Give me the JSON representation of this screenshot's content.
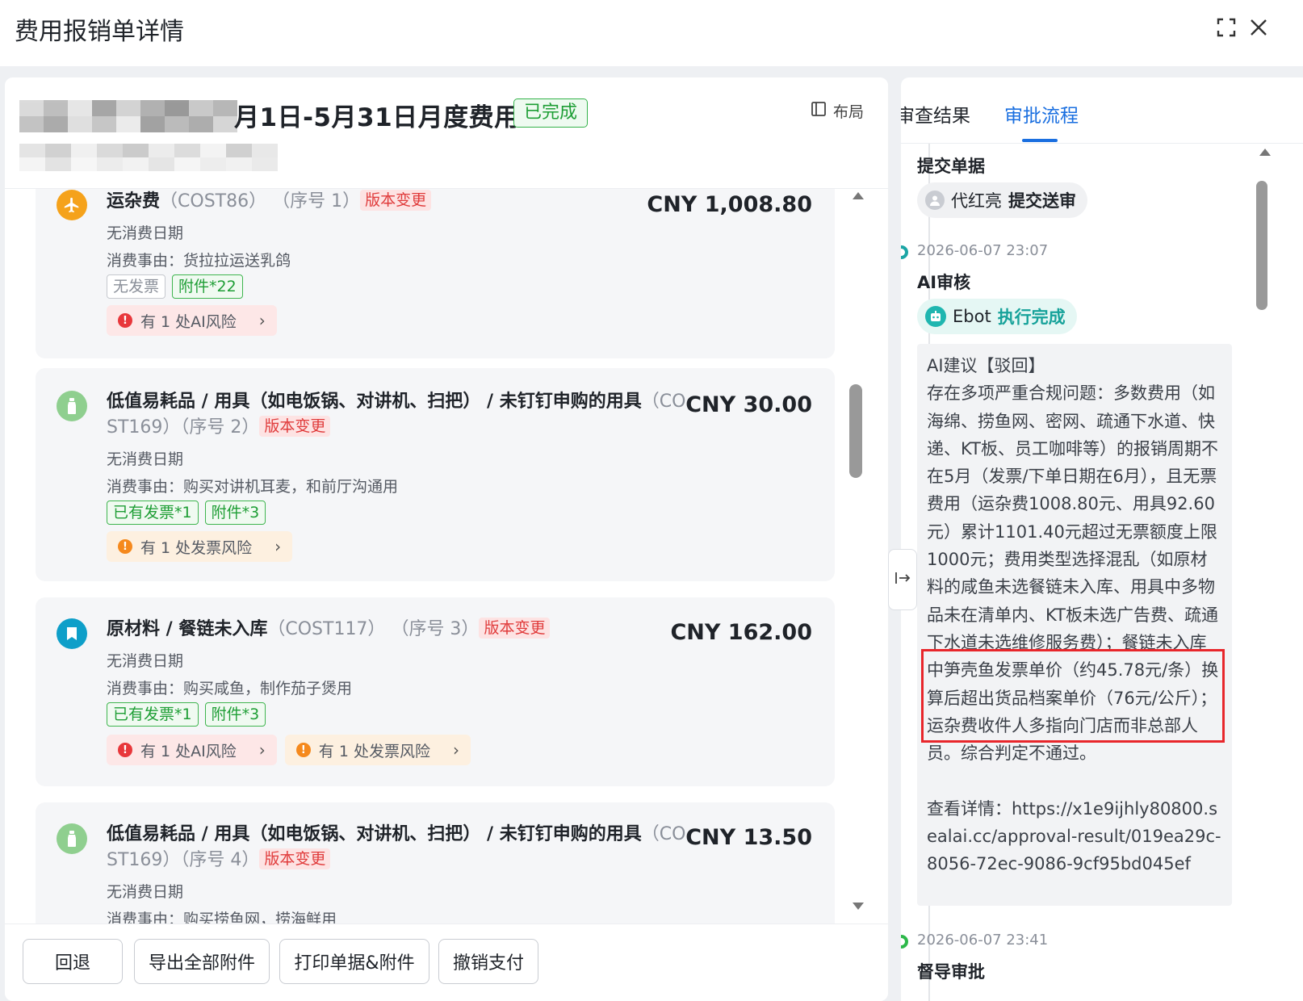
{
  "modal": {
    "title": "费用报销单详情"
  },
  "header": {
    "title_visible": "月1日-5月31日月度费用",
    "status": "已完成",
    "layout_label": "布局"
  },
  "items": [
    {
      "icon": "airplane-icon",
      "icon_color": "#f5a21b",
      "name": "运杂费",
      "code": "（COST86）",
      "seq": "（序号 1）",
      "version_tag": "版本变更",
      "amount": "CNY 1,008.80",
      "date": "无消费日期",
      "reason": "消费事由：货拉拉运送乳鸽",
      "tags": [
        "无发票",
        "附件*22"
      ],
      "risks": [
        "有 1 处AI风险"
      ]
    },
    {
      "icon": "bottle-icon",
      "icon_color": "#8fcf8f",
      "name": "低值易耗品 / 用具（如电饭锅、对讲机、扫把） / 未钉钉申购的用具",
      "code_a": "（CO",
      "code_b": "ST169）",
      "seq": "（序号 2）",
      "version_tag": "版本变更",
      "amount": "CNY 30.00",
      "date": "无消费日期",
      "reason": "消费事由：购买对讲机耳麦，和前厅沟通用",
      "tags": [
        "已有发票*1",
        "附件*3"
      ],
      "risks": [
        "有 1 处发票风险"
      ]
    },
    {
      "icon": "bookmark-icon",
      "icon_color": "#0e9fc9",
      "name": "原材料 / 餐链未入库",
      "code": "（COST117）",
      "seq": "（序号 3）",
      "version_tag": "版本变更",
      "amount": "CNY 162.00",
      "date": "无消费日期",
      "reason": "消费事由：购买咸鱼，制作茄子煲用",
      "tags": [
        "已有发票*1",
        "附件*3"
      ],
      "risks": [
        "有 1 处AI风险",
        "有 1 处发票风险"
      ]
    },
    {
      "icon": "bottle-icon",
      "icon_color": "#8fcf8f",
      "name": "低值易耗品 / 用具（如电饭锅、对讲机、扫把） / 未钉钉申购的用具",
      "code_a": "（CO",
      "code_b": "ST169）",
      "seq": "（序号 4）",
      "version_tag": "版本变更",
      "amount": "CNY 13.50",
      "date": "无消费日期",
      "reason": "消费事由：购买捞鱼网，捞海鲜用"
    }
  ],
  "footer": {
    "buttons": [
      "回退",
      "导出全部附件",
      "打印单据&附件",
      "撤销支付"
    ]
  },
  "right": {
    "tabs": [
      "审查结果",
      "审批流程"
    ],
    "active_tab": "审批流程",
    "timeline": [
      {
        "title": "提交单据",
        "person": "代红亮",
        "action": "提交送审"
      },
      {
        "time": "2026-06-07 23:07",
        "title": "AI审核",
        "person": "Ebot",
        "action": "执行完成",
        "advice": "AI建议【驳回】\n存在多项严重合规问题：多数费用（如海绵、捞鱼网、密网、疏通下水道、快递、KT板、员工咖啡等）的报销周期不在5月（发票/下单日期在6月），且无票费用（运杂费1008.80元、用具92.60元）累计1101.40元超过无票额度上限1000元；费用类型选择混乱（如原材料的咸鱼未选餐链未入库、用具中多物品未在清单内、KT板未选广告费、疏通下水道未选维修服务费）；餐链未入库中笋壳鱼发票单价（约45.78元/条）换算后超出货品档案单价（76元/公斤）；运杂费收件人多指向门店而非总部人员。综合判定不通过。\n\n查看详情：https://x1e9ijhly80800.sealai.cc/approval-result/019ea29c-8056-72ec-9086-9cf95bd045ef"
      },
      {
        "time": "2026-06-07 23:41",
        "title": "督导审批"
      }
    ]
  },
  "colors": {
    "accent": "#1a6fe0",
    "success": "#1e9e35",
    "danger": "#e03b3b",
    "highlight_box": "#e8262b"
  }
}
